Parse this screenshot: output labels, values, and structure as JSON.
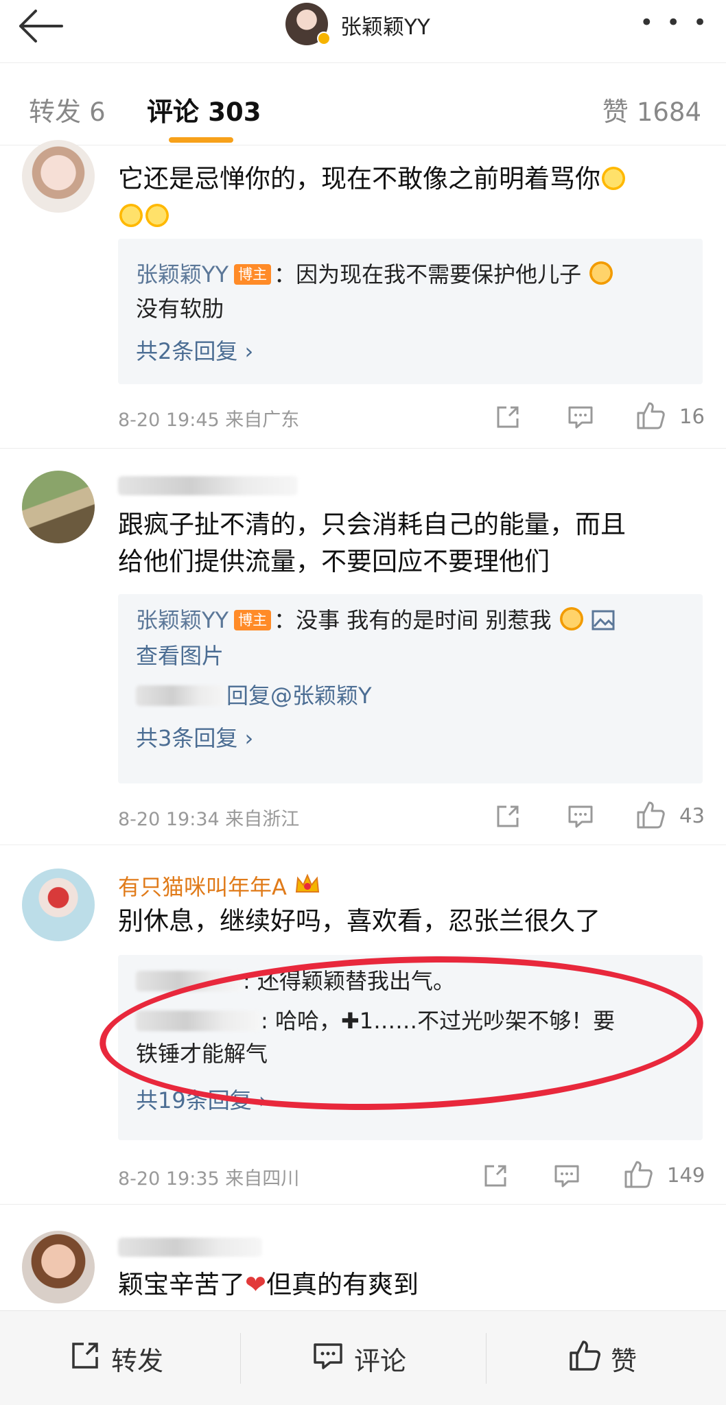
{
  "header": {
    "title": "张颖颖YY",
    "more_label": "• • •"
  },
  "tabs": {
    "repost_label": "转发",
    "repost_count": "6",
    "comment_label": "评论",
    "comment_count": "303",
    "like_label": "赞",
    "like_count": "1684"
  },
  "comments": [
    {
      "text_line1": "它还是忌惮你的，现在不敢像之前明着骂你",
      "reply": {
        "author": "张颖颖YY",
        "badge": "博主",
        "text_line1": "：因为现在我不需要保护他儿子",
        "text_line2": "没有软肋",
        "more": "共2条回复 ›"
      },
      "time": "8-20 19:45",
      "location": "来自广东",
      "likes": "16"
    },
    {
      "text_line1": "跟疯子扯不清的，只会消耗自己的能量，而且",
      "text_line2": "给他们提供流量，不要回应不要理他们",
      "reply": {
        "author": "张颖颖YY",
        "badge": "博主",
        "text_line1": "：没事 我有的是时间 别惹我",
        "image_link": "查看图片",
        "sub_reply": "回复@张颖颖Y",
        "more": "共3条回复 ›"
      },
      "time": "8-20 19:34",
      "location": "来自浙江",
      "likes": "43"
    },
    {
      "username": "有只猫咪叫年年A",
      "text_line1": "别休息，继续好吗，喜欢看，忍张兰很久了",
      "reply": {
        "text_line1": ": 还得颖颖替我出气。",
        "text_line2": ": 哈哈，✚1……不过光吵架不够！要",
        "text_line3": "铁锤才能解气",
        "more": "共19条回复 ›"
      },
      "time": "8-20 19:35",
      "location": "来自四川",
      "likes": "149"
    },
    {
      "text_line1": "颖宝辛苦了",
      "text_line1b": "但真的有爽到"
    }
  ],
  "bottom_bar": {
    "repost": "转发",
    "comment": "评论",
    "like": "赞"
  },
  "colors": {
    "accent": "#f7a11a",
    "link": "#4b6d93",
    "badge": "#ff8b28",
    "vip_name": "#e07b1a",
    "annotation": "#e8283c"
  }
}
